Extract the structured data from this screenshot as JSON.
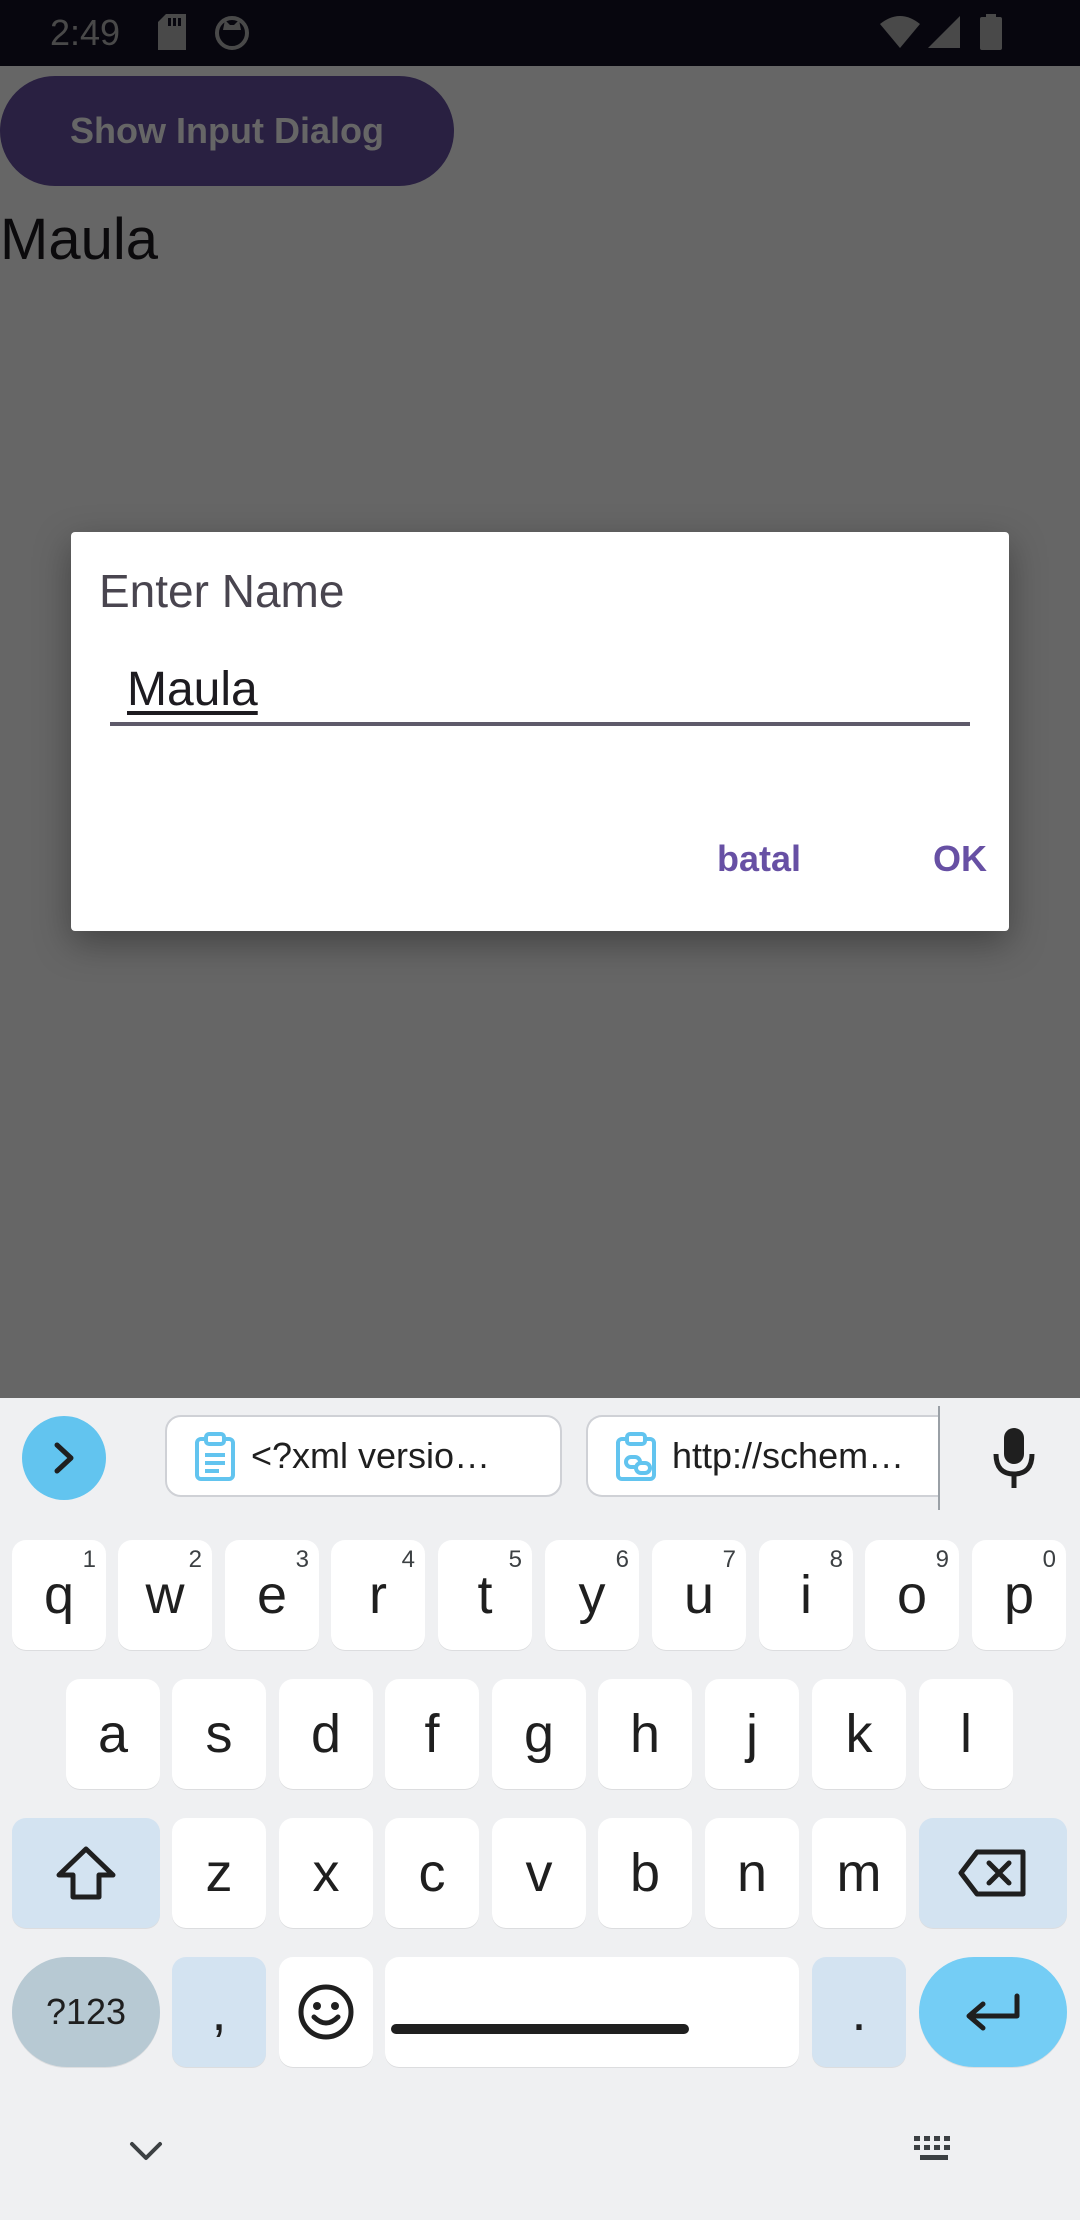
{
  "status_bar": {
    "time": "2:49"
  },
  "app": {
    "show_button_label": "Show Input Dialog",
    "result_text": "Maula"
  },
  "dialog": {
    "title": "Enter Name",
    "input_value": "Maula",
    "cancel_label": "batal",
    "ok_label": "OK"
  },
  "keyboard": {
    "clipboard_chips": [
      {
        "text": "<?xml versio…",
        "icon": "clipboard-icon"
      },
      {
        "text": "http://schem…",
        "icon": "clipboard-link-icon"
      }
    ],
    "row1": [
      {
        "key": "q",
        "hint": "1"
      },
      {
        "key": "w",
        "hint": "2"
      },
      {
        "key": "e",
        "hint": "3"
      },
      {
        "key": "r",
        "hint": "4"
      },
      {
        "key": "t",
        "hint": "5"
      },
      {
        "key": "y",
        "hint": "6"
      },
      {
        "key": "u",
        "hint": "7"
      },
      {
        "key": "i",
        "hint": "8"
      },
      {
        "key": "o",
        "hint": "9"
      },
      {
        "key": "p",
        "hint": "0"
      }
    ],
    "row2": [
      "a",
      "s",
      "d",
      "f",
      "g",
      "h",
      "j",
      "k",
      "l"
    ],
    "row3": [
      "z",
      "x",
      "c",
      "v",
      "b",
      "n",
      "m"
    ],
    "symbols_label": "?123",
    "comma": ",",
    "period": "."
  },
  "colors": {
    "accent": "#6750a4",
    "status_bar_bg": "#1c1833",
    "keyboard_bg": "#eff0f2",
    "modifier_key": "#d3e3f1",
    "enter_key": "#74cdf5"
  }
}
